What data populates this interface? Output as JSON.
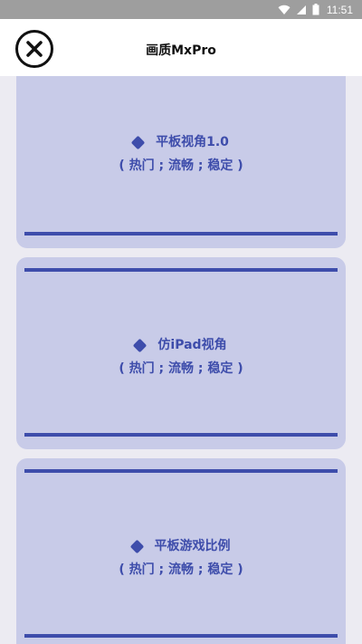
{
  "status_bar": {
    "time": "11:51",
    "icons": [
      "wifi-icon",
      "signal-icon",
      "battery-icon"
    ]
  },
  "header": {
    "title": "画质MxPro",
    "close_icon": "close-icon"
  },
  "cards": [
    {
      "title": "平板视角1.0",
      "tags": "( 热门 ; 流畅 ; 稳定 )"
    },
    {
      "title": "仿iPad视角",
      "tags": "( 热门 ; 流畅 ; 稳定 )"
    },
    {
      "title": "平板游戏比例",
      "tags": "( 热门 ; 流畅 ; 稳定 )"
    }
  ],
  "colors": {
    "accent": "#3e4dab",
    "card_bg": "#c8cbe8",
    "page_bg": "#ecebf2",
    "status_bar_bg": "#9e9e9e"
  }
}
